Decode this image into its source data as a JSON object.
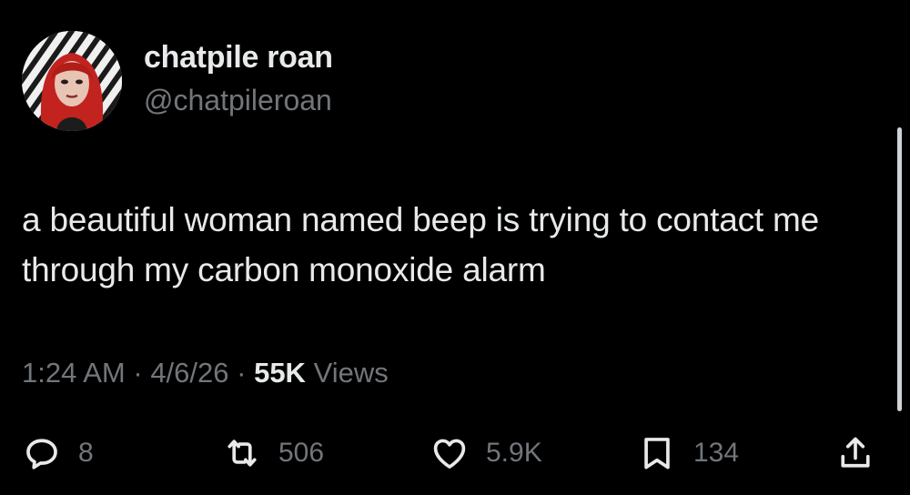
{
  "author": {
    "display_name": "chatpile roan",
    "handle": "@chatpileroan"
  },
  "tweet": {
    "text": "a beautiful woman named beep is trying to contact me through my carbon monoxide alarm"
  },
  "meta": {
    "time": "1:24 AM",
    "separator": "·",
    "date": "4/6/26",
    "views_count": "55K",
    "views_label": "Views"
  },
  "actions": {
    "replies": "8",
    "reposts": "506",
    "likes": "5.9K",
    "bookmarks": "134"
  },
  "icons": [
    "reply-icon",
    "repost-icon",
    "like-icon",
    "bookmark-icon",
    "share-icon"
  ],
  "colors": {
    "background": "#000000",
    "primary_text": "#e7e9ea",
    "secondary_text": "#71767b"
  }
}
